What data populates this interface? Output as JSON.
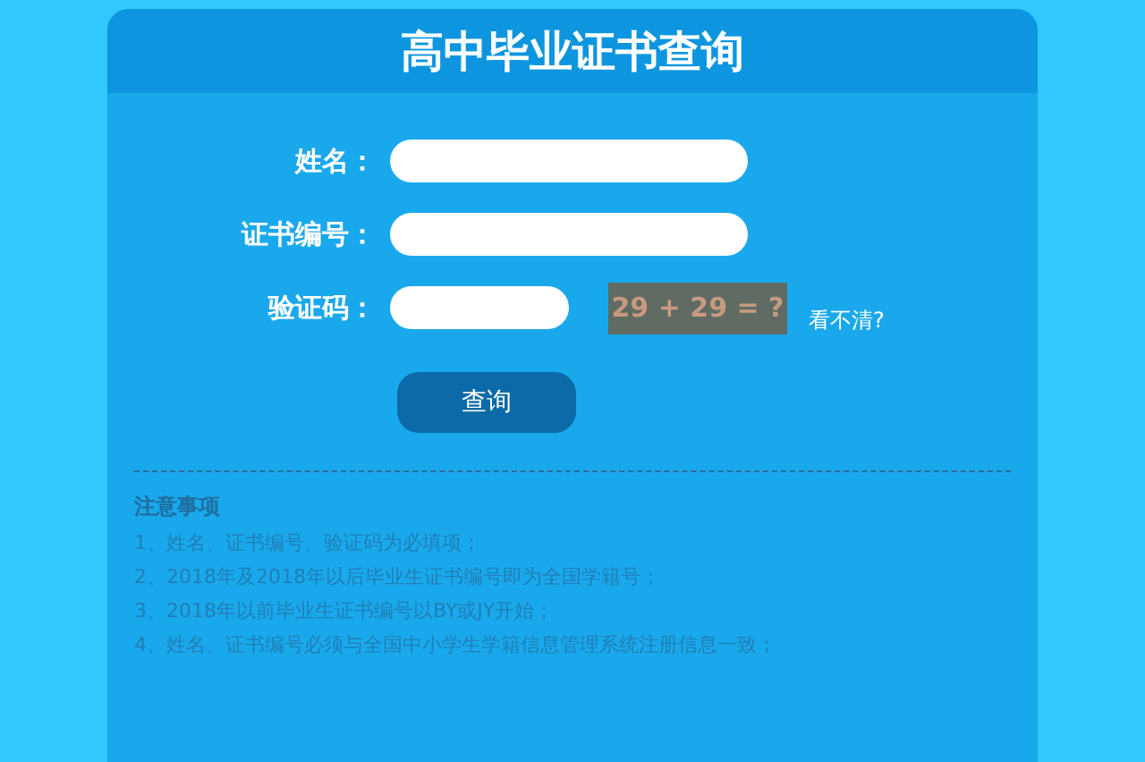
{
  "title": "高中毕业证书查询",
  "fields": [
    {
      "label": "姓名：",
      "kind": "wide"
    },
    {
      "label": "证书编号：",
      "kind": "wide"
    },
    {
      "label": "验证码：",
      "kind": "captcha"
    }
  ],
  "captcha": {
    "text": "29 + 29 = ?",
    "refresh": "看不清?"
  },
  "submit": "查询",
  "notes": {
    "title": "注意事项",
    "items": [
      "1、姓名、证书编号、验证码为必填项；",
      "2、2018年及2018年以后毕业生证书编号即为全国学籍号；",
      "3、2018年以前毕业生证书编号以BY或JY开始；",
      "4、姓名、证书编号必须与全国中小学生学籍信息管理系统注册信息一致；"
    ]
  }
}
